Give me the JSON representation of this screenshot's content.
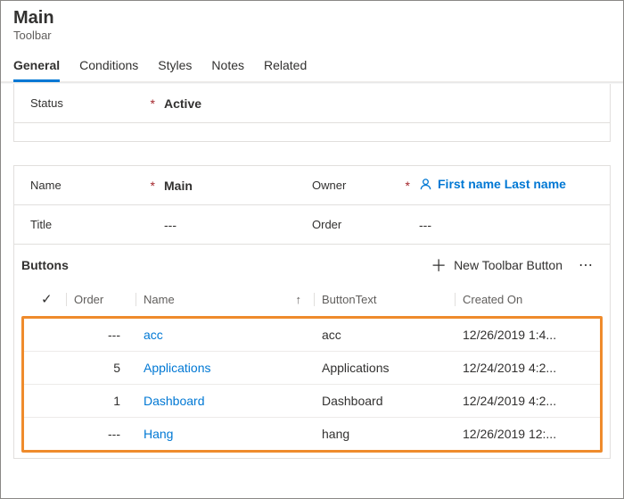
{
  "header": {
    "title": "Main",
    "subtitle": "Toolbar"
  },
  "tabs": [
    "General",
    "Conditions",
    "Styles",
    "Notes",
    "Related"
  ],
  "status": {
    "label": "Status",
    "value": "Active"
  },
  "name": {
    "label": "Name",
    "value": "Main"
  },
  "owner": {
    "label": "Owner",
    "value": "First name Last name"
  },
  "titleField": {
    "label": "Title",
    "value": "---"
  },
  "order": {
    "label": "Order",
    "value": "---"
  },
  "buttons": {
    "section_label": "Buttons",
    "new_label": "New Toolbar Button",
    "columns": {
      "order": "Order",
      "name": "Name",
      "button_text": "ButtonText",
      "created_on": "Created On"
    },
    "rows": [
      {
        "order": "---",
        "name": "acc",
        "button_text": "acc",
        "created_on": "12/26/2019 1:4..."
      },
      {
        "order": "5",
        "name": "Applications",
        "button_text": "Applications",
        "created_on": "12/24/2019 4:2..."
      },
      {
        "order": "1",
        "name": "Dashboard",
        "button_text": "Dashboard",
        "created_on": "12/24/2019 4:2..."
      },
      {
        "order": "---",
        "name": "Hang",
        "button_text": "hang",
        "created_on": "12/26/2019 12:..."
      }
    ]
  }
}
